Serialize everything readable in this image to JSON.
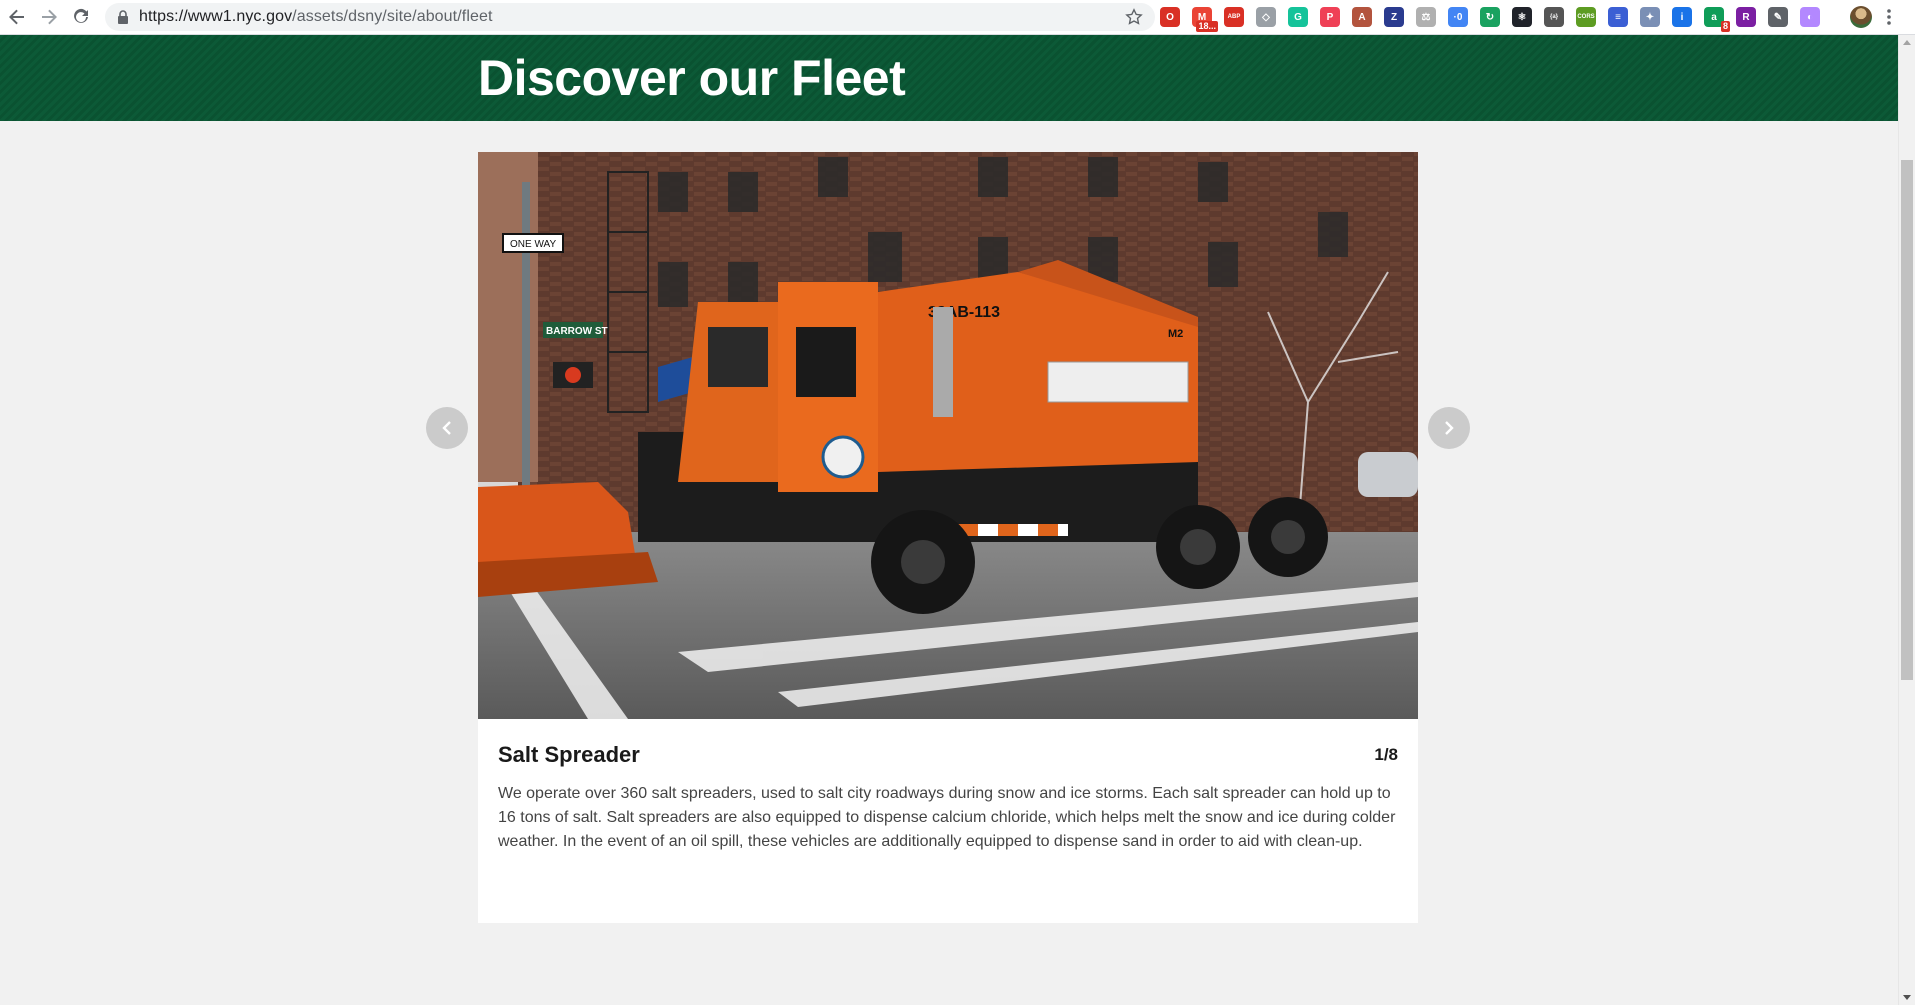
{
  "browser": {
    "url_host": "https://www1.nyc.gov",
    "url_path": "/assets/dsny/site/about/fleet",
    "extensions": [
      {
        "name": "opera-ext-icon",
        "color": "#d93025",
        "glyph": "O"
      },
      {
        "name": "gmail-ext-icon",
        "color": "#ea4335",
        "glyph": "M",
        "badge": "18..."
      },
      {
        "name": "adblock-ext-icon",
        "color": "#d93025",
        "glyph": "ABP"
      },
      {
        "name": "shield-ext-icon",
        "color": "#9aa0a6",
        "glyph": "◇"
      },
      {
        "name": "grammarly-ext-icon",
        "color": "#15c39a",
        "glyph": "G"
      },
      {
        "name": "pocket-ext-icon",
        "color": "#ef4056",
        "glyph": "P"
      },
      {
        "name": "pdf-ext-icon",
        "color": "#b3543e",
        "glyph": "A"
      },
      {
        "name": "zotero-ext-icon",
        "color": "#2a3b8f",
        "glyph": "Z"
      },
      {
        "name": "scale-ext-icon",
        "color": "#b0b0b0",
        "glyph": "⚖"
      },
      {
        "name": "counter-ext-icon",
        "color": "#4285f4",
        "glyph": "·0"
      },
      {
        "name": "refresh-ext-icon",
        "color": "#1aa260",
        "glyph": "↻"
      },
      {
        "name": "react-ext-icon",
        "color": "#20232a",
        "glyph": "⚛"
      },
      {
        "name": "json-ext-icon",
        "color": "#555555",
        "glyph": "{a}"
      },
      {
        "name": "cors-ext-icon",
        "color": "#5d9c22",
        "glyph": "CORS"
      },
      {
        "name": "page-ext-icon",
        "color": "#3b5fd4",
        "glyph": "≡"
      },
      {
        "name": "compass-ext-icon",
        "color": "#7a8fb5",
        "glyph": "✦"
      },
      {
        "name": "info-ext-icon",
        "color": "#1a73e8",
        "glyph": "i"
      },
      {
        "name": "accounts-ext-icon",
        "color": "#0f9d58",
        "glyph": "a",
        "badge": "8"
      },
      {
        "name": "r-ext-icon",
        "color": "#7b1fa2",
        "glyph": "R"
      },
      {
        "name": "eyedropper-ext-icon",
        "color": "#5f6368",
        "glyph": "✎"
      },
      {
        "name": "brush-ext-icon",
        "color": "#b388ff",
        "glyph": "◐"
      }
    ]
  },
  "header": {
    "title": "Discover our Fleet"
  },
  "carousel": {
    "slide_title": "Salt Spreader",
    "counter": "1/8",
    "description": "We operate over 360 salt spreaders, used to salt city roadways during snow and ice storms. Each salt spreader can hold up to 16 tons of salt. Salt spreaders are also equipped to dispense calcium chloride, which helps melt the snow and ice during colder weather. In the event of an oil spill, these vehicles are additionally equipped to dispense sand in order to aid with clean-up.",
    "image_truck_number": "38AB-113",
    "image_street_sign": "BARROW ST",
    "image_oneway_sign": "ONE WAY",
    "image_body_mark": "M2"
  }
}
